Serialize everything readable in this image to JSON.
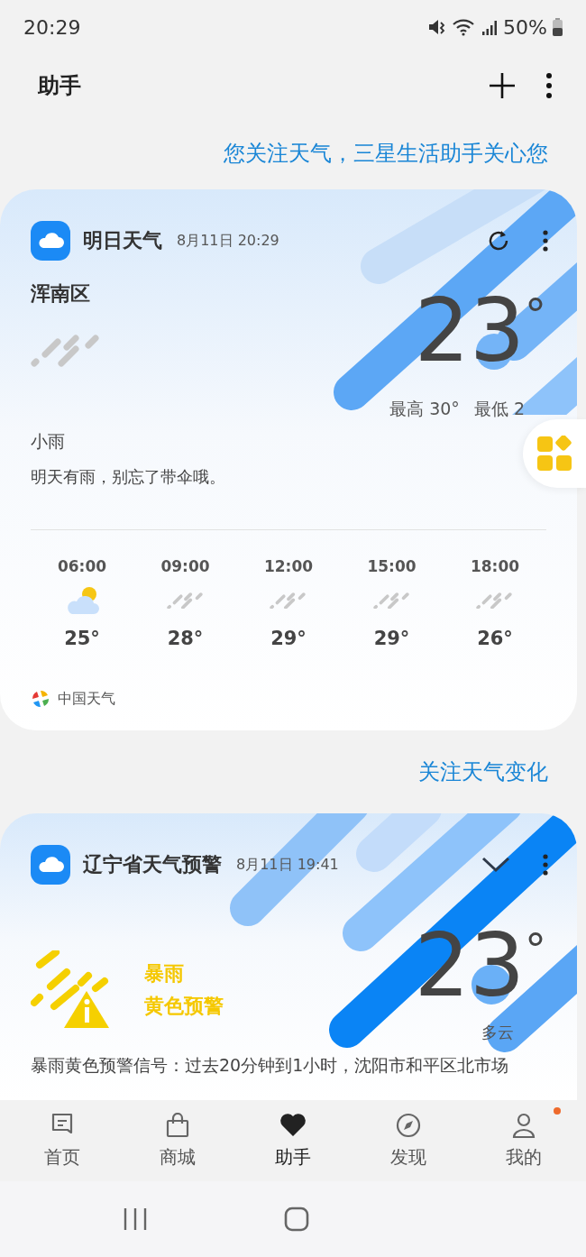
{
  "status_bar": {
    "time": "20:29",
    "battery": "50%"
  },
  "header": {
    "title": "助手"
  },
  "banners": [
    "您关注天气，三星生活助手关心您",
    "关注天气变化"
  ],
  "cards": [
    {
      "kind": "forecast",
      "title": "明日天气",
      "time": "8月11日 20:29",
      "location": "浑南区",
      "temperature": "23",
      "degree": "°",
      "high": "最高 30°",
      "low": "最低 2",
      "condition": "小雨",
      "message": "明天有雨，别忘了带伞哦。",
      "hourly": [
        {
          "time": "06:00",
          "kind": "partly_cloudy",
          "temp": "25°"
        },
        {
          "time": "09:00",
          "kind": "rain",
          "temp": "28°"
        },
        {
          "time": "12:00",
          "kind": "rain",
          "temp": "29°"
        },
        {
          "time": "15:00",
          "kind": "rain",
          "temp": "29°"
        },
        {
          "time": "18:00",
          "kind": "rain",
          "temp": "26°"
        }
      ],
      "source": "中国天气"
    },
    {
      "kind": "warning",
      "title": "辽宁省天气预警",
      "time": "8月11日 19:41",
      "expanded": false,
      "warning_type": "暴雨",
      "warning_level": "黄色预警",
      "temperature": "23",
      "degree": "°",
      "condition": "多云",
      "message": "暴雨黄色预警信号：过去20分钟到1小时，沈阳市和平区北市场"
    }
  ],
  "bottom_nav": [
    {
      "label": "首页",
      "selected": false,
      "notification": false
    },
    {
      "label": "商城",
      "selected": false,
      "notification": false
    },
    {
      "label": "助手",
      "selected": true,
      "notification": false
    },
    {
      "label": "发现",
      "selected": false,
      "notification": false
    },
    {
      "label": "我的",
      "selected": false,
      "notification": true
    }
  ]
}
